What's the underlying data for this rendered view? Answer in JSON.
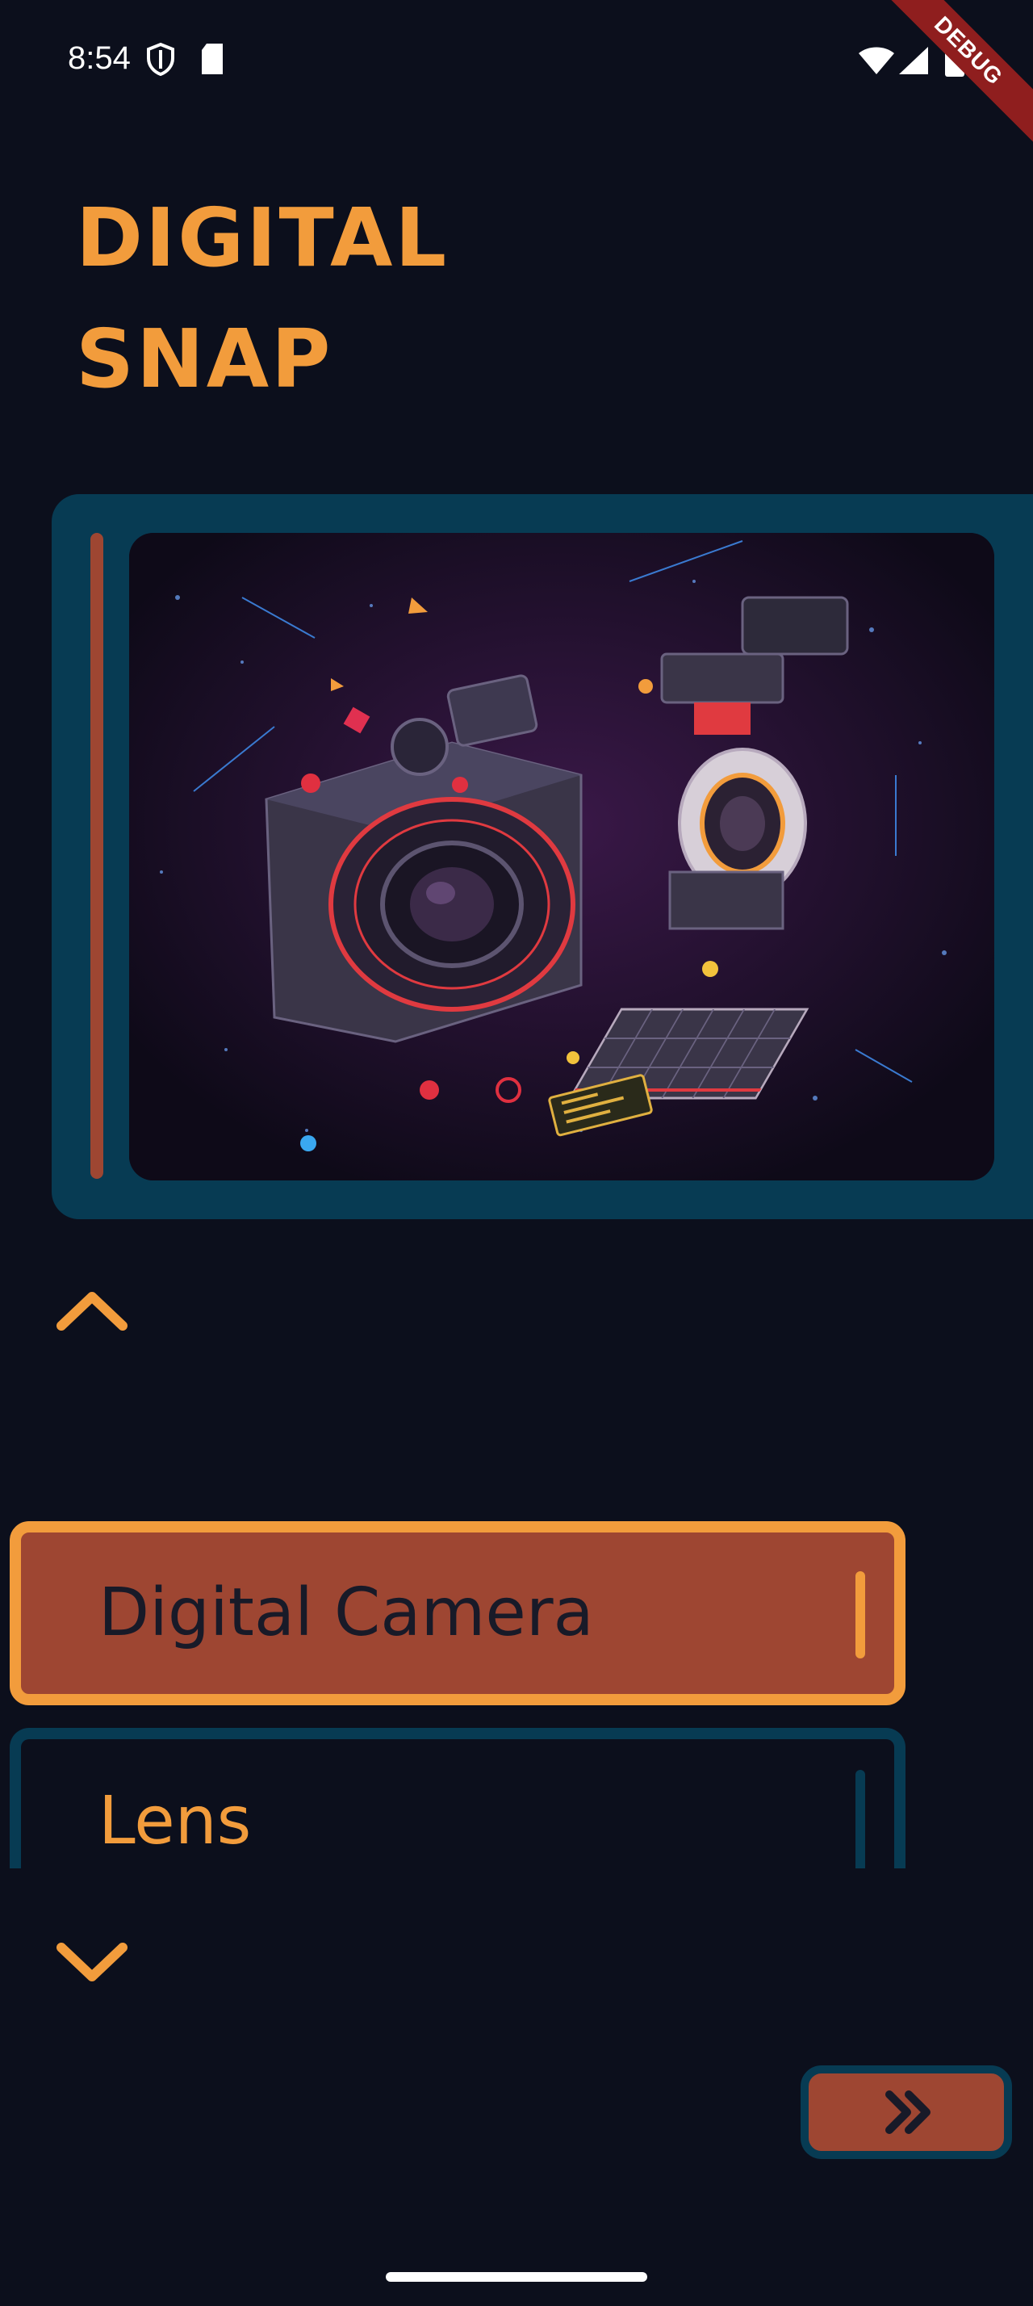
{
  "status_bar": {
    "time": "8:54",
    "icons": [
      "shield-icon",
      "sd-card-icon",
      "wifi-icon",
      "signal-icon",
      "battery-icon"
    ],
    "debug_banner": "DEBUG"
  },
  "app": {
    "title_line1": "DIGITAL",
    "title_line2": "SNAP"
  },
  "hero": {
    "image": "exploded-camera-illustration"
  },
  "carousel": {
    "up_icon": "chevron-up-icon",
    "down_icon": "chevron-down-icon",
    "items": [
      {
        "label": "Digital Camera",
        "selected": true
      },
      {
        "label": "Lens",
        "selected": false
      }
    ]
  },
  "next_button": {
    "icon": "double-chevron-right-icon"
  },
  "colors": {
    "background": "#0c0f1c",
    "accent_orange": "#f29c3c",
    "accent_rust": "#9e4632",
    "teal": "#073b53"
  }
}
